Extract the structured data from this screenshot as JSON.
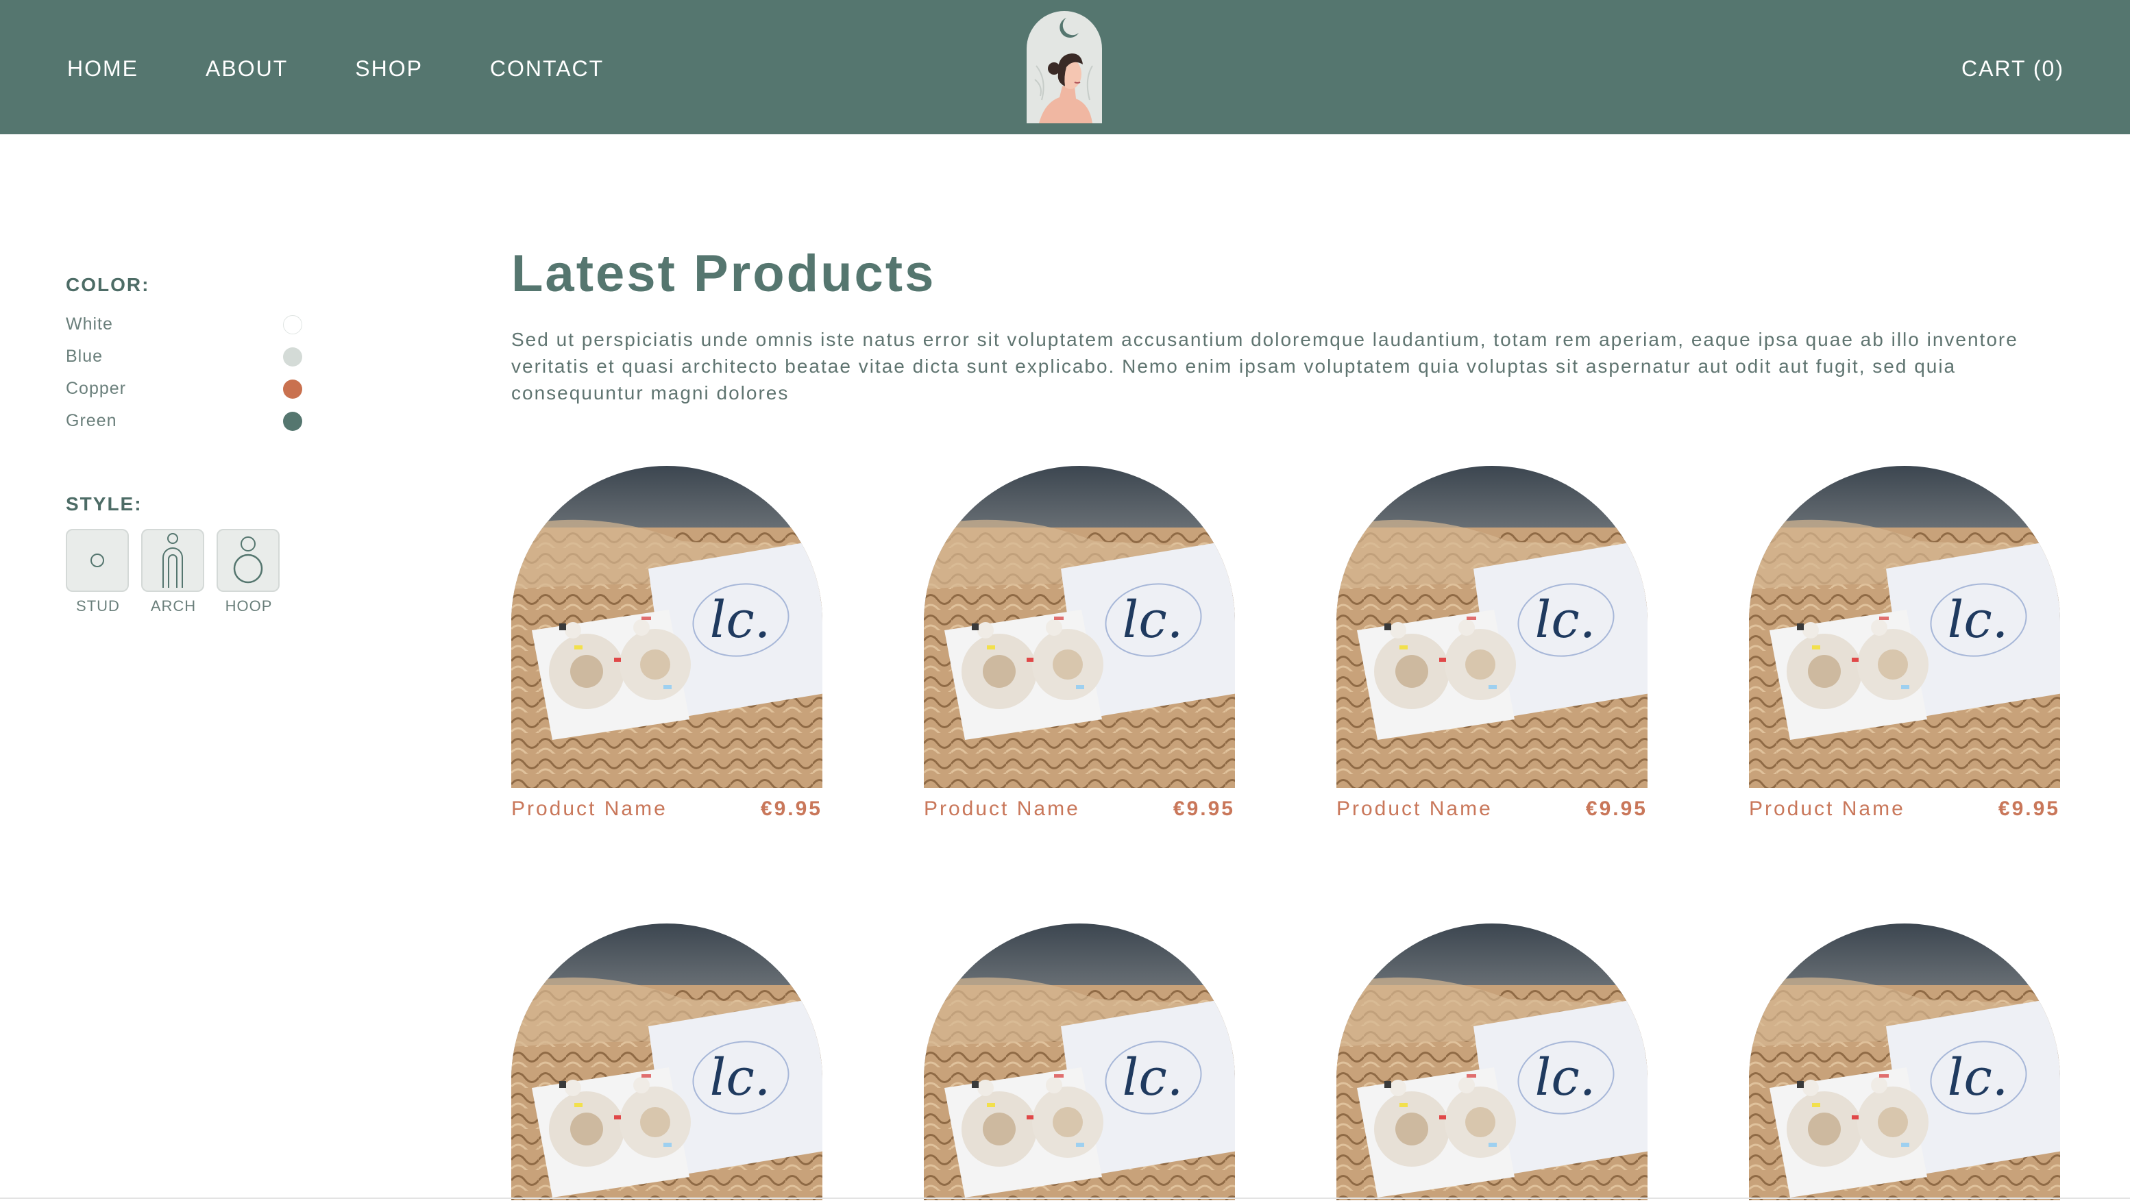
{
  "header": {
    "nav": [
      "HOME",
      "ABOUT",
      "SHOP",
      "CONTACT"
    ],
    "cart_label": "CART (0)",
    "logo_icon": "woman-profile-moon-logo"
  },
  "sidebar": {
    "color_title": "COLOR:",
    "colors": [
      {
        "label": "White",
        "hex": "#ffffff"
      },
      {
        "label": "Blue",
        "hex": "#d4dbd7"
      },
      {
        "label": "Copper",
        "hex": "#c9714f"
      },
      {
        "label": "Green",
        "hex": "#55766f"
      }
    ],
    "style_title": "STYLE:",
    "styles": [
      {
        "label": "STUD",
        "icon": "stud-icon"
      },
      {
        "label": "ARCH",
        "icon": "arch-icon"
      },
      {
        "label": "HOOP",
        "icon": "hoop-icon"
      }
    ]
  },
  "main": {
    "title": "Latest Products",
    "intro": "Sed ut perspiciatis unde omnis iste natus error sit voluptatem accusantium doloremque laudantium, totam rem aperiam, eaque ipsa quae ab illo inventore veritatis et quasi architecto beatae vitae dicta sunt explicabo. Nemo enim ipsam voluptatem quia voluptas sit aspernatur aut odit aut fugit, sed quia consequuntur magni dolores",
    "products": [
      {
        "name": "Product Name",
        "price": "€9.95",
        "image_text": "lc."
      },
      {
        "name": "Product Name",
        "price": "€9.95",
        "image_text": "lc."
      },
      {
        "name": "Product Name",
        "price": "€9.95",
        "image_text": "lc."
      },
      {
        "name": "Product Name",
        "price": "€9.95",
        "image_text": "lc."
      },
      {
        "name": "",
        "price": "",
        "image_text": "lc."
      },
      {
        "name": "",
        "price": "",
        "image_text": "lc."
      },
      {
        "name": "",
        "price": "",
        "image_text": "lc."
      },
      {
        "name": "",
        "price": "",
        "image_text": "lc."
      }
    ]
  },
  "colors": {
    "header_bg": "#55766f",
    "accent_copper": "#c9775a",
    "title_green": "#55766f"
  }
}
